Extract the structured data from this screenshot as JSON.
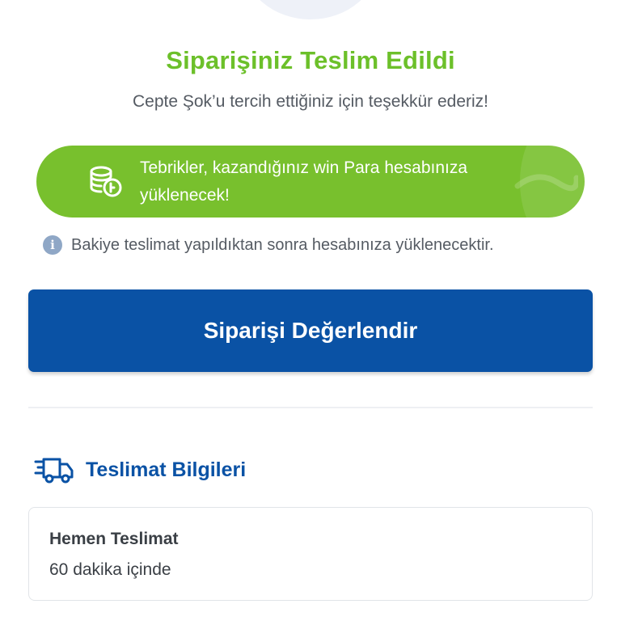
{
  "header": {
    "title": "Siparişiniz Teslim Edildi",
    "subtitle": "Cepte Şok’u tercih ettiğiniz için teşekkür ederiz!"
  },
  "promo": {
    "line1": "Tebrikler, kazandığınız win Para hesabınıza",
    "line2": "yüklenecek!",
    "icon": "coins-icon"
  },
  "info": {
    "icon": "info-icon",
    "text": "Bakiye teslimat yapıldıktan sonra hesabınıza yüklenecektir."
  },
  "rate_button": {
    "label": "Siparişi Değerlendir"
  },
  "delivery": {
    "icon": "truck-icon",
    "section_title": "Teslimat Bilgileri",
    "type": "Hemen Teslimat",
    "eta": "60 dakika içinde"
  },
  "colors": {
    "accent_green": "#6cc02a",
    "promo_green": "#78c02d",
    "primary_blue": "#0a52a5"
  }
}
